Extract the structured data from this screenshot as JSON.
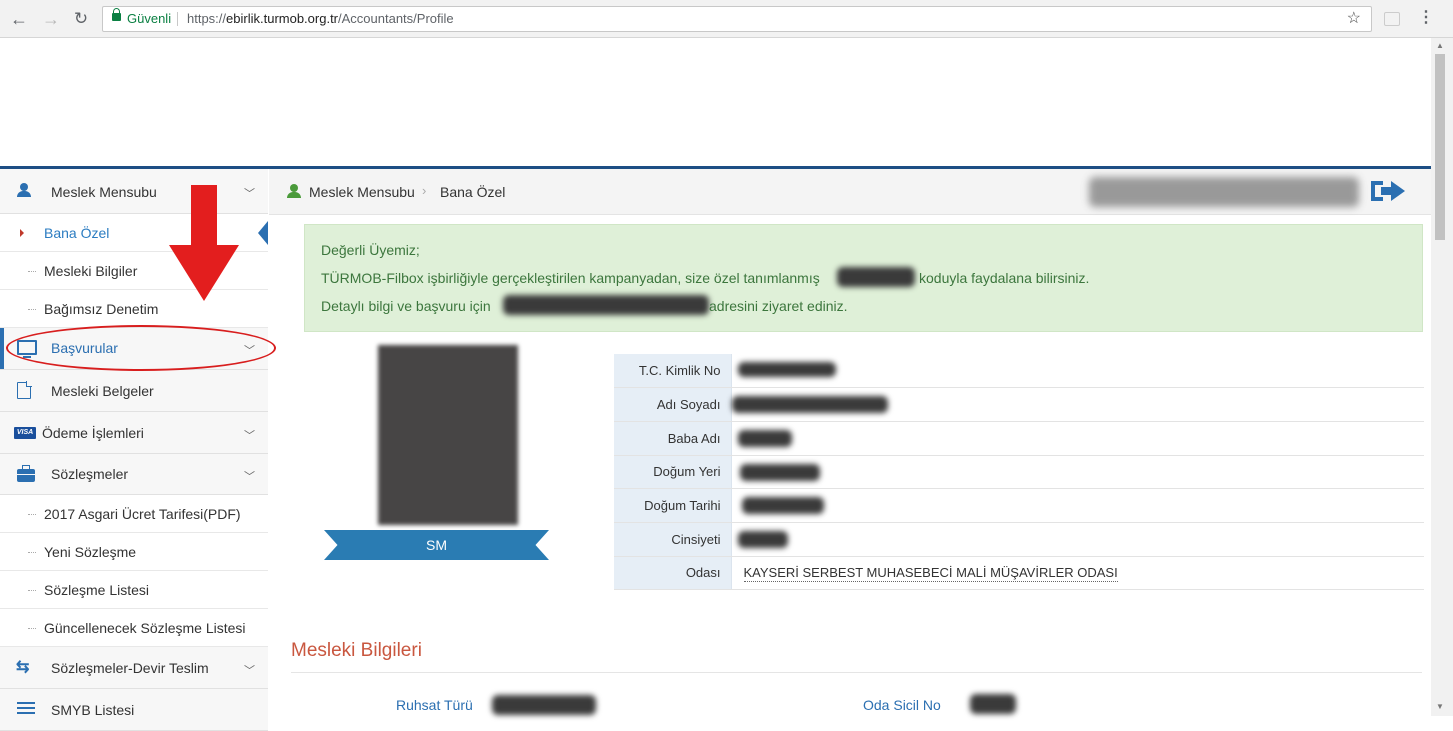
{
  "browser": {
    "secure_label": "Güvenli",
    "url_prefix": "https://",
    "url_host": "ebirlik.turmob.org.tr",
    "url_path": "/Accountants/Profile"
  },
  "sidebar": {
    "items": [
      {
        "label": "Meslek Mensubu",
        "icon": "user-icon",
        "has_chevron": true
      },
      {
        "label": "Bana Özel",
        "sub": true,
        "active": true
      },
      {
        "label": "Mesleki Bilgiler",
        "sub": true
      },
      {
        "label": "Bağımsız Denetim",
        "sub": true
      },
      {
        "label": "Başvurular",
        "icon": "monitor-icon",
        "has_chevron": true,
        "highlighted": true
      },
      {
        "label": "Mesleki Belgeler",
        "icon": "document-icon"
      },
      {
        "label": "Ödeme İşlemleri",
        "icon": "visa-icon",
        "has_chevron": true
      },
      {
        "label": "Sözleşmeler",
        "icon": "briefcase-icon",
        "has_chevron": true
      },
      {
        "label": "2017 Asgari Ücret Tarifesi(PDF)",
        "sub": true
      },
      {
        "label": "Yeni Sözleşme",
        "sub": true
      },
      {
        "label": "Sözleşme Listesi",
        "sub": true
      },
      {
        "label": "Güncellenecek Sözleşme Listesi",
        "sub": true
      },
      {
        "label": "Sözleşmeler-Devir Teslim",
        "icon": "swap-icon",
        "has_chevron": true
      },
      {
        "label": "SMYB Listesi",
        "icon": "list-icon"
      }
    ]
  },
  "breadcrumb": {
    "root": "Meslek Mensubu",
    "current": "Bana Özel"
  },
  "alert": {
    "line1": "Değerli Üyemiz;",
    "line2_a": "TÜRMOB-Filbox işbirliğiyle gerçekleştirilen kampanyadan, size özel tanımlanmış",
    "line2_b": "koduyla faydalana bilirsiniz.",
    "line3_a": "Detaylı bilgi ve başvuru için",
    "line3_b": "adresini ziyaret ediniz."
  },
  "profile": {
    "badge": "SM",
    "fields": [
      {
        "label": "T.C. Kimlik No",
        "value": ""
      },
      {
        "label": "Adı Soyadı",
        "value": ""
      },
      {
        "label": "Baba Adı",
        "value": ""
      },
      {
        "label": "Doğum Yeri",
        "value": ""
      },
      {
        "label": "Doğum Tarihi",
        "value": ""
      },
      {
        "label": "Cinsiyeti",
        "value": ""
      },
      {
        "label": "Odası",
        "value": "KAYSERİ SERBEST MUHASEBECİ MALİ MÜŞAVİRLER ODASI"
      }
    ]
  },
  "section": {
    "title": "Mesleki Bilgileri",
    "ruhsat_label": "Ruhsat Türü",
    "oda_sicil_label": "Oda Sicil No"
  },
  "colors": {
    "accent": "#2b6fb1",
    "alert_bg": "#dff0d8",
    "alert_text": "#3c763d",
    "annotation": "#d81e1e",
    "section_title": "#c9573f"
  }
}
